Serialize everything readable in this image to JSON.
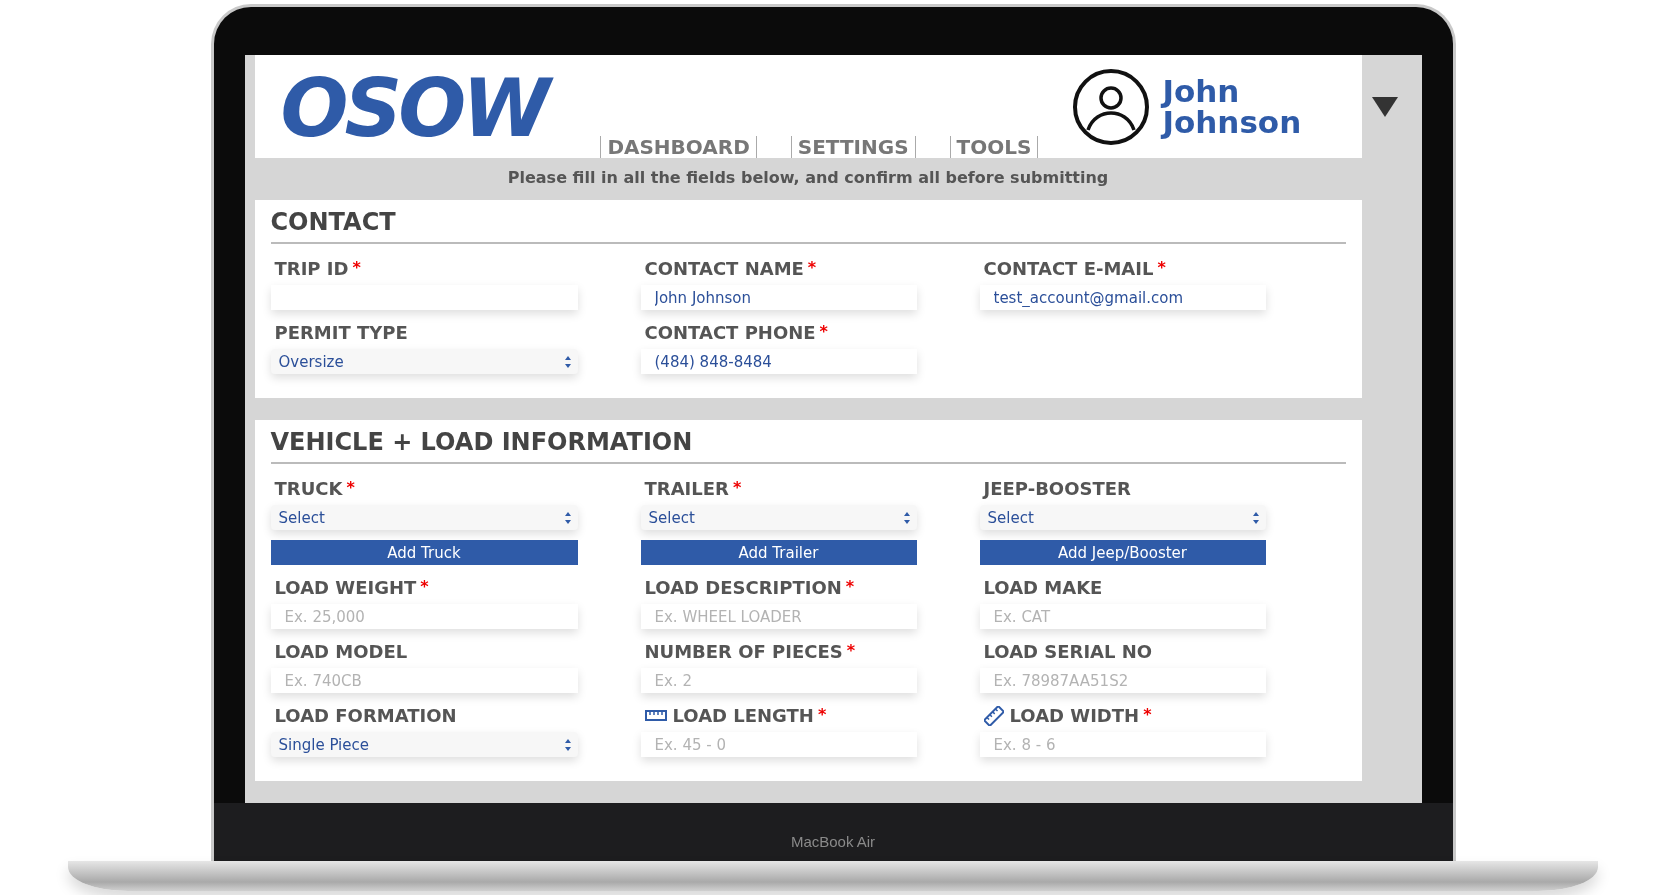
{
  "device": {
    "label": "MacBook Air"
  },
  "header": {
    "logo": "OSOW",
    "nav": [
      {
        "label": "DASHBOARD"
      },
      {
        "label": "SETTINGS"
      },
      {
        "label": "TOOLS"
      }
    ],
    "user": {
      "first": "John",
      "last": "Johnson"
    }
  },
  "notice": "Please fill in all the fields below, and confirm all before submitting",
  "sections": [
    {
      "title": "CONTACT",
      "fields": [
        {
          "label": "TRIP ID",
          "required_mark": "*",
          "kind": "text"
        },
        {
          "label": "CONTACT NAME",
          "required_mark": "*",
          "kind": "text",
          "value": "John Johnson"
        },
        {
          "label": "CONTACT E-MAIL",
          "required_mark": "*",
          "kind": "text",
          "value": "test_account@gmail.com"
        },
        {
          "label": "PERMIT TYPE",
          "kind": "select",
          "value": "Oversize"
        },
        {
          "label": "CONTACT PHONE",
          "required_mark": "*",
          "kind": "text",
          "value": "(484) 848-8484"
        }
      ]
    },
    {
      "title": "VEHICLE + LOAD INFORMATION",
      "fields": [
        {
          "label": "TRUCK",
          "required_mark": "*",
          "kind": "select",
          "value": "Select",
          "button": "Add Truck"
        },
        {
          "label": "TRAILER",
          "required_mark": "*",
          "kind": "select",
          "value": "Select",
          "button": "Add Trailer"
        },
        {
          "label": "JEEP-BOOSTER",
          "kind": "select",
          "value": "Select",
          "button": "Add Jeep/Booster"
        },
        {
          "label": "LOAD WEIGHT",
          "required_mark": "*",
          "kind": "text",
          "placeholder": "Ex. 25,000"
        },
        {
          "label": "LOAD DESCRIPTION",
          "required_mark": "*",
          "kind": "text",
          "placeholder": "Ex. WHEEL LOADER"
        },
        {
          "label": "LOAD MAKE",
          "kind": "text",
          "placeholder": "Ex. CAT"
        },
        {
          "label": "LOAD MODEL",
          "kind": "text",
          "placeholder": "Ex. 740CB"
        },
        {
          "label": "NUMBER OF PIECES",
          "required_mark": "*",
          "kind": "text",
          "placeholder": "Ex. 2"
        },
        {
          "label": "LOAD SERIAL NO",
          "kind": "text",
          "placeholder": "Ex. 78987AA51S2"
        },
        {
          "label": "LOAD FORMATION",
          "kind": "select",
          "value": "Single Piece"
        },
        {
          "label": "LOAD LENGTH",
          "required_mark": "*",
          "kind": "text",
          "placeholder": "Ex. 45 - 0"
        },
        {
          "label": "LOAD WIDTH",
          "required_mark": "*",
          "kind": "text",
          "placeholder": "Ex. 8 - 6"
        }
      ]
    }
  ]
}
